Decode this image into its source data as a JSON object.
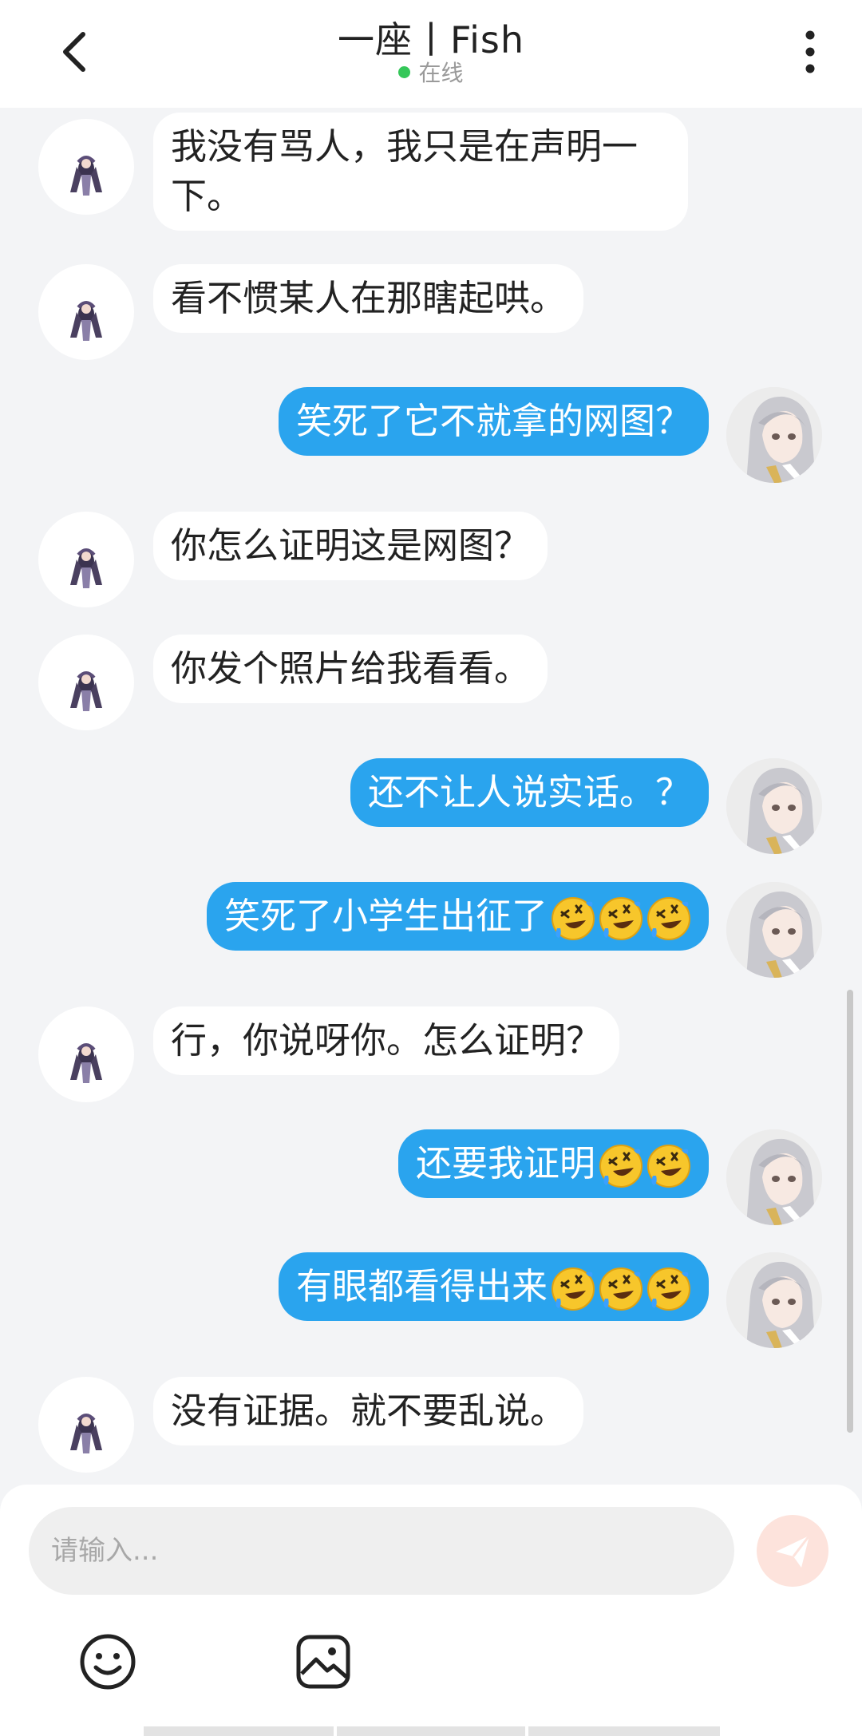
{
  "header": {
    "title": "一座丨Fish",
    "status": "在线"
  },
  "messages": [
    {
      "from": "other",
      "text": "我没有骂人，我只是在声明一下。"
    },
    {
      "from": "other",
      "text": "看不惯某人在那瞎起哄。"
    },
    {
      "from": "me",
      "text": "笑死了它不就拿的网图？"
    },
    {
      "from": "other",
      "text": "你怎么证明这是网图？"
    },
    {
      "from": "other",
      "text": "你发个照片给我看看。"
    },
    {
      "from": "me",
      "text": "还不让人说实话。？"
    },
    {
      "from": "me",
      "text": "笑死了小学生出征了",
      "emoji": "rofl-emoji",
      "emoji_count": 3
    },
    {
      "from": "other",
      "text": "行，你说呀你。怎么证明？"
    },
    {
      "from": "me",
      "text": "还要我证明",
      "emoji": "rofl-emoji",
      "emoji_count": 2
    },
    {
      "from": "me",
      "text": "有眼都看得出来",
      "emoji": "rofl-emoji",
      "emoji_count": 3
    },
    {
      "from": "other",
      "text": "没有证据。就不要乱说。"
    }
  ],
  "composer": {
    "placeholder": "请输入...",
    "send_icon": "send-icon",
    "emoji_icon": "smiley-icon",
    "image_icon": "image-icon"
  },
  "colors": {
    "my_bubble": "#2aa4ee",
    "other_bubble": "#ffffff",
    "online_dot": "#35c759",
    "send_button": "#fde3dc"
  }
}
